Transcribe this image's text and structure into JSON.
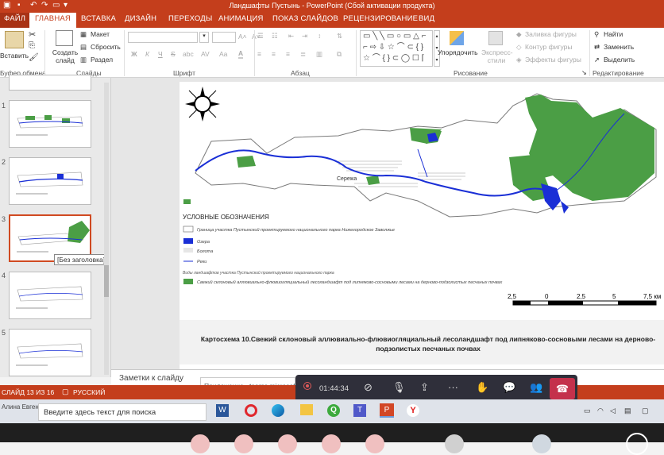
{
  "window": {
    "title": "Ландшафты Пустынь - PowerPoint (Сбой активации продукта)"
  },
  "tabs": {
    "file": "ФАЙЛ",
    "home": "ГЛАВНАЯ",
    "insert": "ВСТАВКА",
    "design": "ДИЗАЙН",
    "transitions": "ПЕРЕХОДЫ",
    "animation": "АНИМАЦИЯ",
    "slideshow": "ПОКАЗ СЛАЙДОВ",
    "review": "РЕЦЕНЗИРОВАНИЕ",
    "view": "ВИД"
  },
  "ribbon": {
    "clipboard": {
      "paste": "Вставить",
      "label": "Буфер обмена"
    },
    "slides": {
      "new_slide": "Создать слайд",
      "layout": "Макет",
      "reset": "Сбросить",
      "section": "Раздел",
      "label": "Слайды"
    },
    "font": {
      "label": "Шрифт",
      "bold": "Ж",
      "italic": "К",
      "underline": "Ч",
      "strike": "S",
      "shadow": "abc",
      "spacing": "AV",
      "case": "Aa"
    },
    "paragraph": {
      "label": "Абзац"
    },
    "drawing": {
      "arrange": "Упорядочить",
      "quick_styles": "Экспресс-стили",
      "fill": "Заливка фигуры",
      "outline": "Контур фигуры",
      "effects": "Эффекты фигуры",
      "label": "Рисование"
    },
    "editing": {
      "find": "Найти",
      "replace": "Заменить",
      "select": "Выделить",
      "label": "Редактирование"
    }
  },
  "thumbnails": {
    "numbers": [
      "1",
      "2",
      "3",
      "4",
      "5"
    ],
    "tooltip": "[Без заголовка]"
  },
  "slide": {
    "legend_title": "УСЛОВНЫЕ ОБОЗНАЧЕНИЯ",
    "legend_boundary": "Граница участка Пустынский проектируемого национального парка Нижегородское Заволжье",
    "legend_lakes": "Озера",
    "legend_swamps": "Болота",
    "legend_rivers": "Реки",
    "legend_types": "Виды ландшафтов участка Пустынский проектируемого национального парка",
    "legend_landscape": "Свежий склоновый аллювиально-флювиогляциальный лесоландшафт под липняково-сосновыми лесами на дерново-подзолистых песчаных почвах",
    "river_name": "Сережа",
    "scale_labels": [
      "2,5",
      "0",
      "2,5",
      "5",
      "7,5 км"
    ],
    "caption": "Картосхема 10.Свежий склоновый аллювиально-флювиогляциальный лесоландшафт под липняково-сосновыми лесами на дерново-подзолистых песчаных почвах"
  },
  "notes": {
    "placeholder": "Заметки к слайду"
  },
  "status": {
    "slide": "СЛАЙД 13 ИЗ 16",
    "language": "РУССКИЙ"
  },
  "teams": {
    "notification": "Приложение «teams.microsoft.com»...",
    "timer": "01:44:34"
  },
  "taskbar": {
    "search": "Введите здесь текст для поиска",
    "user": "Алина Евгеньевна Кочнева"
  },
  "colors": {
    "accent": "#c43e1c",
    "green": "#4b9e45",
    "blue": "#1a2fd6",
    "call_end": "#c4314b"
  }
}
